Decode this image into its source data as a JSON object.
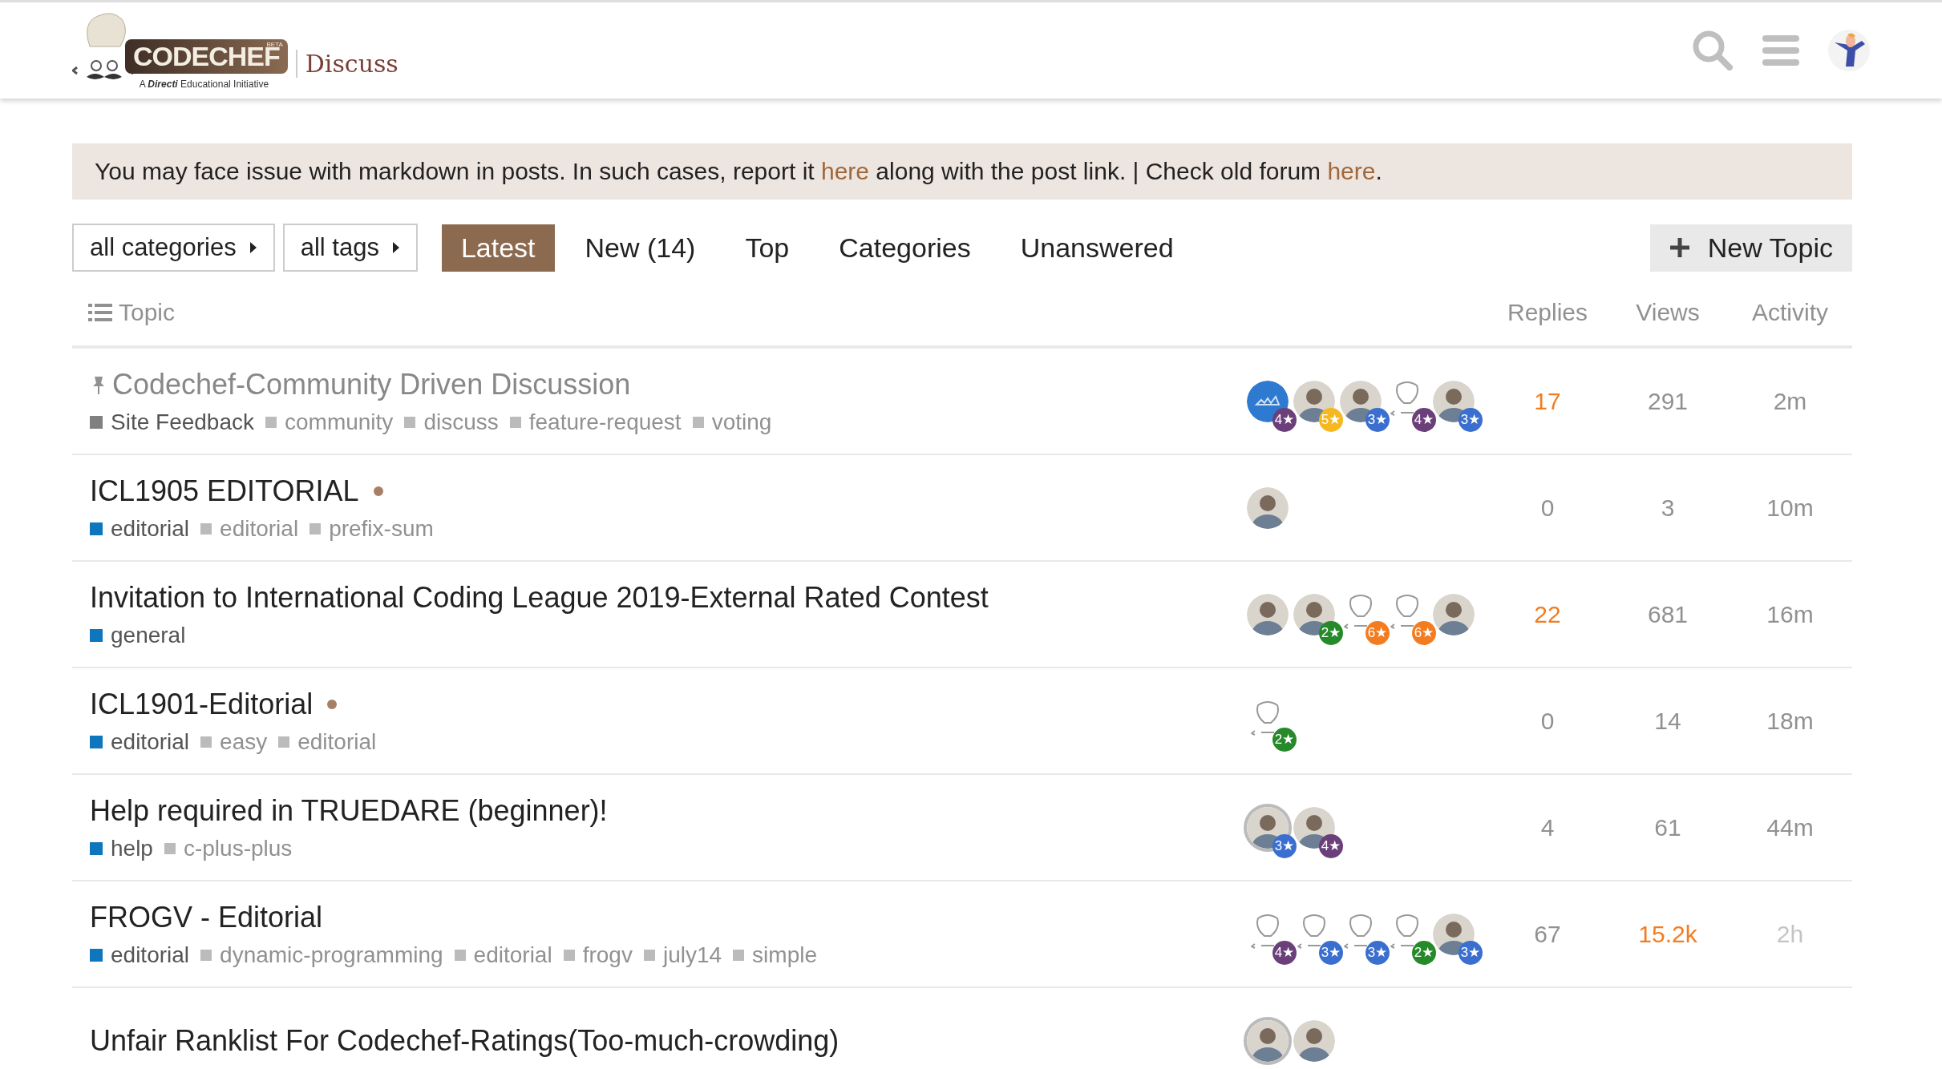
{
  "header": {
    "logo": {
      "name": "CODECHEF",
      "beta": "BETA",
      "tagline": "A **Directi** Educational Initiative",
      "section": "Discuss"
    }
  },
  "banner": {
    "segments": [
      {
        "text": "You may face issue with markdown in posts. In such cases, report it ",
        "link": false
      },
      {
        "text": "here",
        "link": true
      },
      {
        "text": " along with the post link. | Check old forum ",
        "link": false
      },
      {
        "text": "here",
        "link": true
      },
      {
        "text": ".",
        "link": false
      }
    ]
  },
  "nav": {
    "filters": [
      {
        "label": "all categories"
      },
      {
        "label": "all tags"
      }
    ],
    "tabs": [
      {
        "label": "Latest",
        "selected": true
      },
      {
        "label": "New (14)",
        "selected": false
      },
      {
        "label": "Top",
        "selected": false
      },
      {
        "label": "Categories",
        "selected": false
      },
      {
        "label": "Unanswered",
        "selected": false
      }
    ],
    "new_topic": "New Topic"
  },
  "table": {
    "columns": [
      "Topic",
      "Replies",
      "Views",
      "Activity"
    ],
    "topics": [
      {
        "title": "Codechef-Community Driven Discussion",
        "pinned": true,
        "visited": true,
        "unread": false,
        "category": {
          "name": "Site Feedback",
          "color": "#808080"
        },
        "tags": [
          "community",
          "discuss",
          "feature-request",
          "voting"
        ],
        "posters": [
          {
            "kind": "logo",
            "ring": false,
            "badge": "4★",
            "color": "#6b3f7a"
          },
          {
            "kind": "photo",
            "ring": false,
            "badge": "5★",
            "color": "#f6b821"
          },
          {
            "kind": "photo",
            "ring": false,
            "badge": "3★",
            "color": "#3a6fcf"
          },
          {
            "kind": "chef",
            "ring": false,
            "badge": "4★",
            "color": "#6b3f7a"
          },
          {
            "kind": "photo",
            "ring": false,
            "badge": "3★",
            "color": "#3a6fcf"
          }
        ],
        "replies": {
          "text": "17",
          "hot": true
        },
        "views": {
          "text": "291",
          "hot": false
        },
        "activity": {
          "text": "2m",
          "old": false
        }
      },
      {
        "title": "ICL1905 EDITORIAL",
        "pinned": false,
        "visited": false,
        "unread": true,
        "category": {
          "name": "editorial",
          "color": "#0e76bd"
        },
        "tags": [
          "editorial",
          "prefix-sum"
        ],
        "posters": [
          {
            "kind": "photo",
            "ring": false
          }
        ],
        "replies": {
          "text": "0",
          "hot": false
        },
        "views": {
          "text": "3",
          "hot": false
        },
        "activity": {
          "text": "10m",
          "old": false
        }
      },
      {
        "title": "Invitation to International Coding League 2019-External Rated Contest",
        "pinned": false,
        "visited": false,
        "unread": false,
        "category": {
          "name": "general",
          "color": "#0e76bd"
        },
        "posters": [
          {
            "kind": "photo",
            "ring": false
          },
          {
            "kind": "photo",
            "ring": false,
            "badge": "2★",
            "color": "#268a2a"
          },
          {
            "kind": "chef",
            "ring": false,
            "badge": "6★",
            "color": "#f47c20"
          },
          {
            "kind": "chef",
            "ring": false,
            "badge": "6★",
            "color": "#f47c20"
          },
          {
            "kind": "photo",
            "ring": false
          }
        ],
        "replies": {
          "text": "22",
          "hot": true
        },
        "views": {
          "text": "681",
          "hot": false
        },
        "activity": {
          "text": "16m",
          "old": false
        }
      },
      {
        "title": "ICL1901-Editorial",
        "pinned": false,
        "visited": false,
        "unread": true,
        "category": {
          "name": "editorial",
          "color": "#0e76bd"
        },
        "tags": [
          "easy",
          "editorial"
        ],
        "posters": [
          {
            "kind": "chef",
            "ring": false,
            "badge": "2★",
            "color": "#268a2a"
          }
        ],
        "replies": {
          "text": "0",
          "hot": false
        },
        "views": {
          "text": "14",
          "hot": false
        },
        "activity": {
          "text": "18m",
          "old": false
        }
      },
      {
        "title": "Help required in TRUEDARE (beginner)!",
        "pinned": false,
        "visited": false,
        "unread": false,
        "category": {
          "name": "help",
          "color": "#0e76bd"
        },
        "tags": [
          "c-plus-plus"
        ],
        "posters": [
          {
            "kind": "photo",
            "ring": true,
            "badge": "3★",
            "color": "#3a6fcf"
          },
          {
            "kind": "photo",
            "ring": false,
            "badge": "4★",
            "color": "#6b3f7a"
          }
        ],
        "replies": {
          "text": "4",
          "hot": false
        },
        "views": {
          "text": "61",
          "hot": false
        },
        "activity": {
          "text": "44m",
          "old": false
        }
      },
      {
        "title": "FROGV - Editorial",
        "pinned": false,
        "visited": false,
        "unread": false,
        "category": {
          "name": "editorial",
          "color": "#0e76bd"
        },
        "tags": [
          "dynamic-programming",
          "editorial",
          "frogv",
          "july14",
          "simple"
        ],
        "posters": [
          {
            "kind": "chef",
            "ring": false,
            "badge": "4★",
            "color": "#6b3f7a"
          },
          {
            "kind": "chef",
            "ring": false,
            "badge": "3★",
            "color": "#3a6fcf"
          },
          {
            "kind": "chef",
            "ring": false,
            "badge": "3★",
            "color": "#3a6fcf"
          },
          {
            "kind": "chef",
            "ring": false,
            "badge": "2★",
            "color": "#268a2a"
          },
          {
            "kind": "photo",
            "ring": false,
            "badge": "3★",
            "color": "#3a6fcf"
          }
        ],
        "replies": {
          "text": "67",
          "hot": false
        },
        "views": {
          "text": "15.2k",
          "hot": true
        },
        "activity": {
          "text": "2h",
          "old": true
        }
      },
      {
        "title": "Unfair Ranklist For Codechef-Ratings(Too-much-crowding)",
        "pinned": false,
        "visited": false,
        "unread": false,
        "posters": [
          {
            "kind": "photo",
            "ring": true
          },
          {
            "kind": "photo",
            "ring": false
          }
        ]
      }
    ]
  }
}
